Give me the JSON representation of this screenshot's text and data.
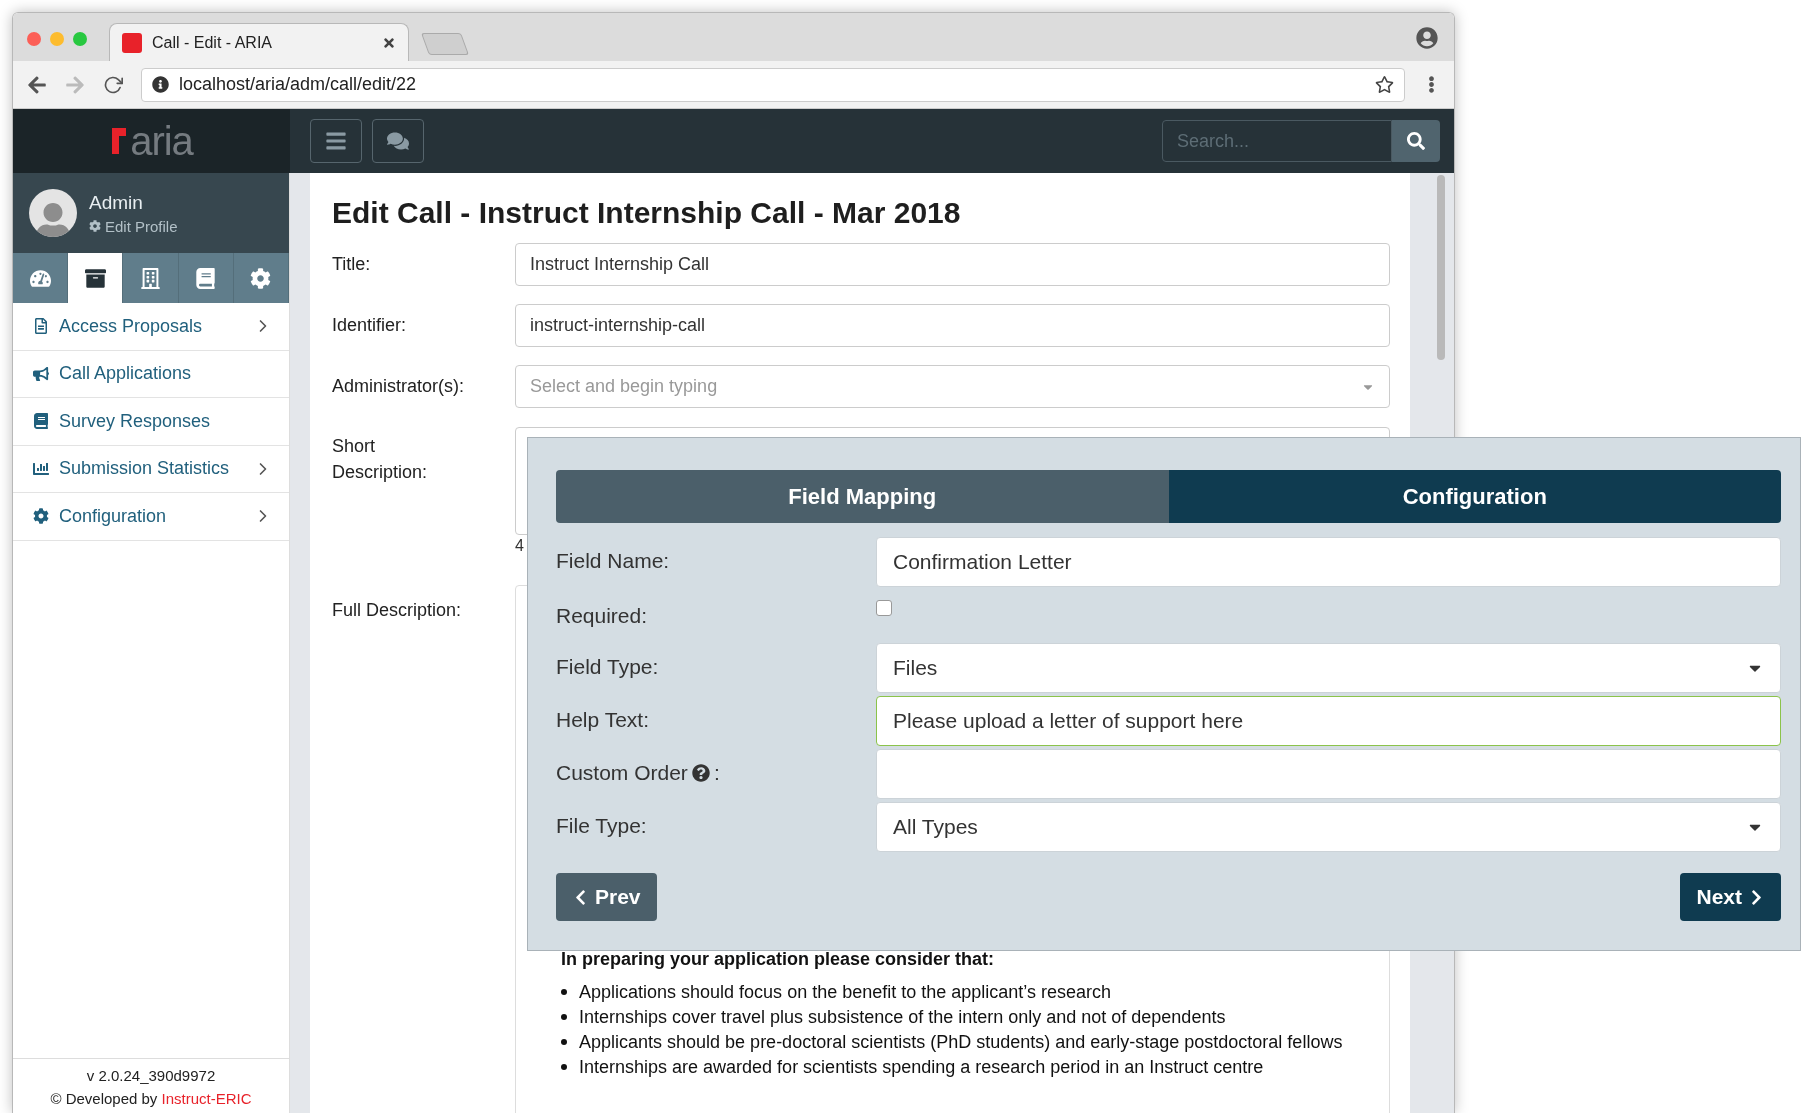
{
  "browser": {
    "tab_title": "Call - Edit - ARIA",
    "url": "localhost/aria/adm/call/edit/22"
  },
  "header": {
    "logo": "aria",
    "search": {
      "placeholder": "Search..."
    }
  },
  "sidebar": {
    "user": {
      "name": "Admin",
      "link": "Edit Profile"
    },
    "icon_tabs": [
      {
        "selected": false
      },
      {
        "selected": true
      },
      {
        "selected": false
      },
      {
        "selected": false
      },
      {
        "selected": false
      }
    ],
    "items": [
      {
        "label": "Access Proposals",
        "expandable": true
      },
      {
        "label": "Call Applications",
        "expandable": false
      },
      {
        "label": "Survey Responses",
        "expandable": false
      },
      {
        "label": "Submission Statistics",
        "expandable": true
      },
      {
        "label": "Configuration",
        "expandable": true
      }
    ],
    "footer": {
      "version": "v 2.0.24_390d9972",
      "credit": "© Developed by",
      "credit_link": "Instruct-ERIC"
    }
  },
  "form": {
    "title": "Edit Call - Instruct Internship Call - Mar 2018",
    "fields": [
      {
        "kind": "text",
        "label": "Title:",
        "value": "Instruct Internship Call"
      },
      {
        "kind": "text",
        "label": "Identifier:",
        "value": "instruct-internship-call"
      },
      {
        "kind": "select",
        "label": "Administrator(s):",
        "placeholder": "Select and begin typing"
      },
      {
        "kind": "textarea",
        "label": "Short Description:",
        "counter": "4"
      },
      {
        "kind": "editor",
        "label": "Full Description:",
        "heading": "In preparing your application please consider that:",
        "bullets": [
          "Applications should focus on the benefit to the applicant’s research",
          "Internships cover travel plus subsistence of the intern only and not of  dependents",
          "Applicants should be pre-doctoral scientists (PhD students) and early-stage postdoctoral fellows",
          "Internships are awarded for scientists spending a research period in an Instruct centre"
        ]
      }
    ]
  },
  "dialog": {
    "tabs": [
      {
        "label": "Field Mapping",
        "selected": false
      },
      {
        "label": "Configuration",
        "selected": true
      }
    ],
    "rows": [
      {
        "kind": "text",
        "label": "Field Name:",
        "value": "Confirmation Letter",
        "focused": false
      },
      {
        "kind": "checkbox",
        "label": "Required:",
        "checked": false
      },
      {
        "kind": "select",
        "label": "Field Type:",
        "value": "Files"
      },
      {
        "kind": "text",
        "label": "Help Text:",
        "value": "Please upload a letter of support here",
        "focused": true
      },
      {
        "kind": "text",
        "label": "Custom Order",
        "label_suffix": ":",
        "help": true,
        "focused": false
      },
      {
        "kind": "select",
        "label": "File Type:",
        "value": "All Types"
      }
    ],
    "prev": "Prev",
    "next": "Next"
  }
}
